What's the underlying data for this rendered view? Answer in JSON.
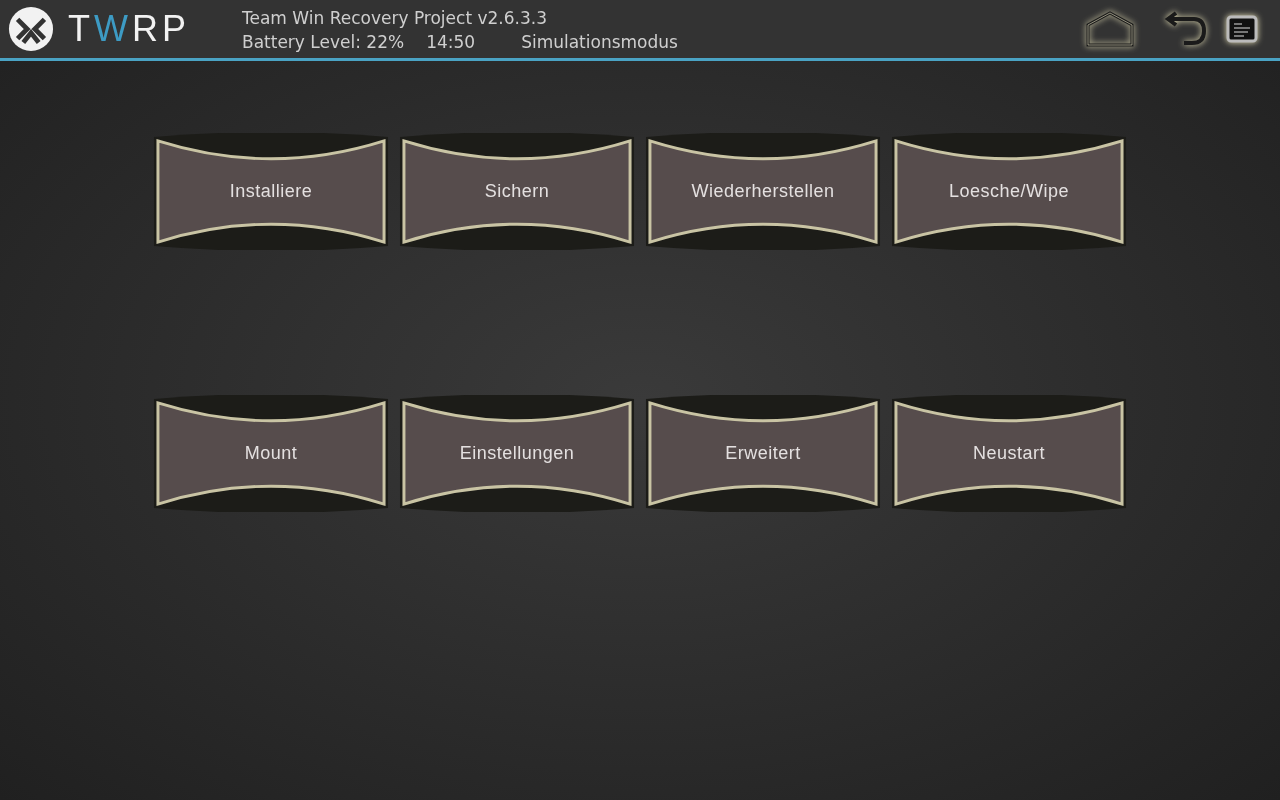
{
  "header": {
    "logo": [
      {
        "text": "T",
        "color": "#f2f2f2"
      },
      {
        "text": "W",
        "color": "#3d9bc4"
      },
      {
        "text": "RP",
        "color": "#f2f2f2"
      }
    ],
    "title": "Team Win Recovery Project  v2.6.3.3",
    "battery": "Battery Level: 22%",
    "time": "14:50",
    "mode": "Simulationsmodus"
  },
  "rows": [
    [
      "Installiere",
      "Sichern",
      "Wiederherstellen",
      "Loesche/Wipe"
    ],
    [
      "Mount",
      "Einstellungen",
      "Erweitert",
      "Neustart"
    ]
  ]
}
